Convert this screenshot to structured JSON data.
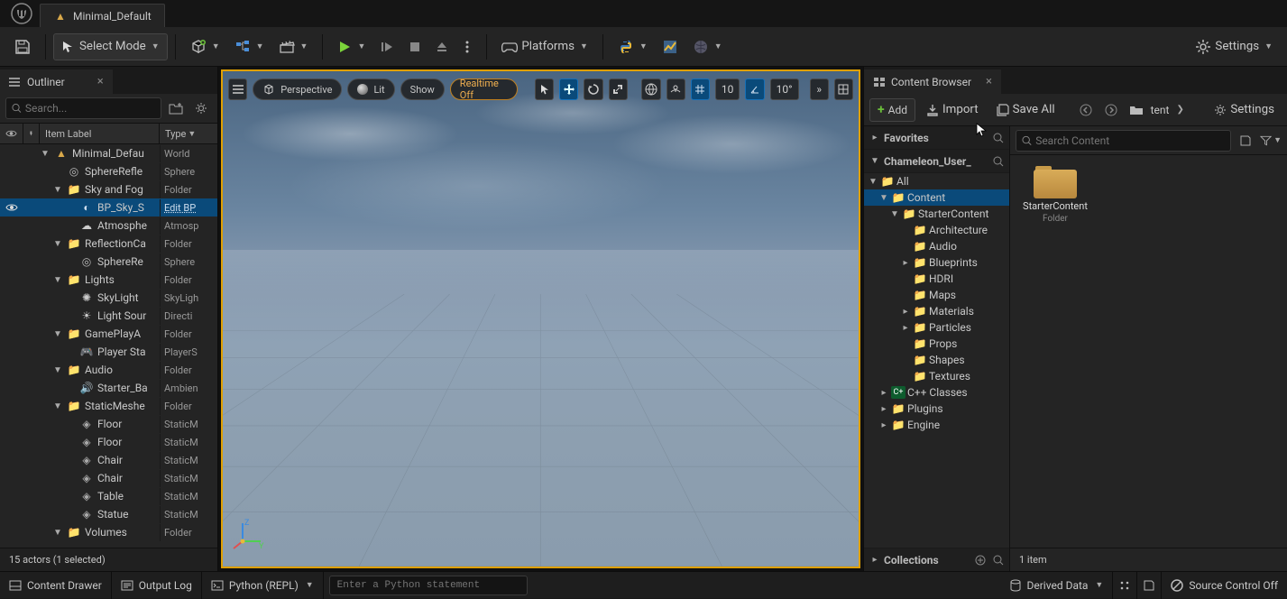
{
  "app": {
    "level_tab": "Minimal_Default"
  },
  "toolbar": {
    "select_mode": "Select Mode",
    "platforms": "Platforms",
    "settings": "Settings"
  },
  "outliner": {
    "title": "Outliner",
    "search_placeholder": "Search...",
    "header": {
      "item_label": "Item Label",
      "type": "Type"
    },
    "rows": [
      {
        "d": 1,
        "tw": "▼",
        "icon": "level",
        "label": "Minimal_Defau",
        "type": "World",
        "eye": false
      },
      {
        "d": 2,
        "tw": "",
        "icon": "comp",
        "label": "SphereRefle",
        "type": "Sphere",
        "eye": false
      },
      {
        "d": 2,
        "tw": "▼",
        "icon": "folder",
        "label": "Sky and Fog",
        "type": "Folder",
        "eye": false
      },
      {
        "d": 3,
        "tw": "",
        "icon": "bp",
        "label": "BP_Sky_S",
        "type": "Edit BP",
        "eye": true,
        "selected": true
      },
      {
        "d": 3,
        "tw": "",
        "icon": "atmos",
        "label": "Atmosphe",
        "type": "Atmosp",
        "eye": false
      },
      {
        "d": 2,
        "tw": "▼",
        "icon": "folder",
        "label": "ReflectionCa",
        "type": "Folder",
        "eye": false
      },
      {
        "d": 3,
        "tw": "",
        "icon": "comp",
        "label": "SphereRe",
        "type": "Sphere",
        "eye": false
      },
      {
        "d": 2,
        "tw": "▼",
        "icon": "folder",
        "label": "Lights",
        "type": "Folder",
        "eye": false
      },
      {
        "d": 3,
        "tw": "",
        "icon": "sky",
        "label": "SkyLight",
        "type": "SkyLigh",
        "eye": false
      },
      {
        "d": 3,
        "tw": "",
        "icon": "light",
        "label": "Light Sour",
        "type": "Directi",
        "eye": false
      },
      {
        "d": 2,
        "tw": "▼",
        "icon": "folder",
        "label": "GamePlayA",
        "type": "Folder",
        "eye": false
      },
      {
        "d": 3,
        "tw": "",
        "icon": "pstart",
        "label": "Player Sta",
        "type": "PlayerS",
        "eye": false
      },
      {
        "d": 2,
        "tw": "▼",
        "icon": "folder",
        "label": "Audio",
        "type": "Folder",
        "eye": false
      },
      {
        "d": 3,
        "tw": "",
        "icon": "audio",
        "label": "Starter_Ba",
        "type": "Ambien",
        "eye": false
      },
      {
        "d": 2,
        "tw": "▼",
        "icon": "folder",
        "label": "StaticMeshe",
        "type": "Folder",
        "eye": false
      },
      {
        "d": 3,
        "tw": "",
        "icon": "mesh",
        "label": "Floor",
        "type": "StaticM",
        "eye": false
      },
      {
        "d": 3,
        "tw": "",
        "icon": "mesh",
        "label": "Floor",
        "type": "StaticM",
        "eye": false
      },
      {
        "d": 3,
        "tw": "",
        "icon": "mesh",
        "label": "Chair",
        "type": "StaticM",
        "eye": false
      },
      {
        "d": 3,
        "tw": "",
        "icon": "mesh",
        "label": "Chair",
        "type": "StaticM",
        "eye": false
      },
      {
        "d": 3,
        "tw": "",
        "icon": "mesh",
        "label": "Table",
        "type": "StaticM",
        "eye": false
      },
      {
        "d": 3,
        "tw": "",
        "icon": "mesh",
        "label": "Statue",
        "type": "StaticM",
        "eye": false
      },
      {
        "d": 2,
        "tw": "▼",
        "icon": "folder",
        "label": "Volumes",
        "type": "Folder",
        "eye": false
      }
    ],
    "footer": "15 actors (1 selected)"
  },
  "viewport": {
    "perspective": "Perspective",
    "lit": "Lit",
    "show": "Show",
    "realtime_off": "Realtime Off",
    "grid_snap": "10",
    "angle_snap": "10°"
  },
  "content_browser": {
    "title": "Content Browser",
    "add": "Add",
    "import": "Import",
    "save_all": "Save All",
    "path_crumb": "tent",
    "settings": "Settings",
    "favorites": "Favorites",
    "project_name": "Chameleon_User_",
    "collections": "Collections",
    "search_placeholder": "Search Content",
    "tree": [
      {
        "d": 0,
        "tw": "▼",
        "label": "All",
        "icon": "folder"
      },
      {
        "d": 1,
        "tw": "▼",
        "label": "Content",
        "icon": "folder",
        "content": true,
        "sel": true
      },
      {
        "d": 2,
        "tw": "▼",
        "label": "StarterContent",
        "icon": "folder"
      },
      {
        "d": 3,
        "tw": "",
        "label": "Architecture",
        "icon": "folder"
      },
      {
        "d": 3,
        "tw": "",
        "label": "Audio",
        "icon": "folder"
      },
      {
        "d": 3,
        "tw": "▸",
        "label": "Blueprints",
        "icon": "folder"
      },
      {
        "d": 3,
        "tw": "",
        "label": "HDRI",
        "icon": "folder"
      },
      {
        "d": 3,
        "tw": "",
        "label": "Maps",
        "icon": "folder"
      },
      {
        "d": 3,
        "tw": "▸",
        "label": "Materials",
        "icon": "folder"
      },
      {
        "d": 3,
        "tw": "▸",
        "label": "Particles",
        "icon": "folder"
      },
      {
        "d": 3,
        "tw": "",
        "label": "Props",
        "icon": "folder"
      },
      {
        "d": 3,
        "tw": "",
        "label": "Shapes",
        "icon": "folder"
      },
      {
        "d": 3,
        "tw": "",
        "label": "Textures",
        "icon": "folder"
      },
      {
        "d": 1,
        "tw": "▸",
        "label": "C++ Classes",
        "icon": "cpp"
      },
      {
        "d": 1,
        "tw": "▸",
        "label": "Plugins",
        "icon": "folder"
      },
      {
        "d": 1,
        "tw": "▸",
        "label": "Engine",
        "icon": "folder"
      }
    ],
    "assets": [
      {
        "name": "StarterContent",
        "type": "Folder"
      }
    ],
    "item_count": "1 item"
  },
  "statusbar": {
    "content_drawer": "Content Drawer",
    "output_log": "Output Log",
    "python": "Python (REPL)",
    "python_placeholder": "Enter a Python statement",
    "derived_data": "Derived Data",
    "source_control": "Source Control Off"
  }
}
